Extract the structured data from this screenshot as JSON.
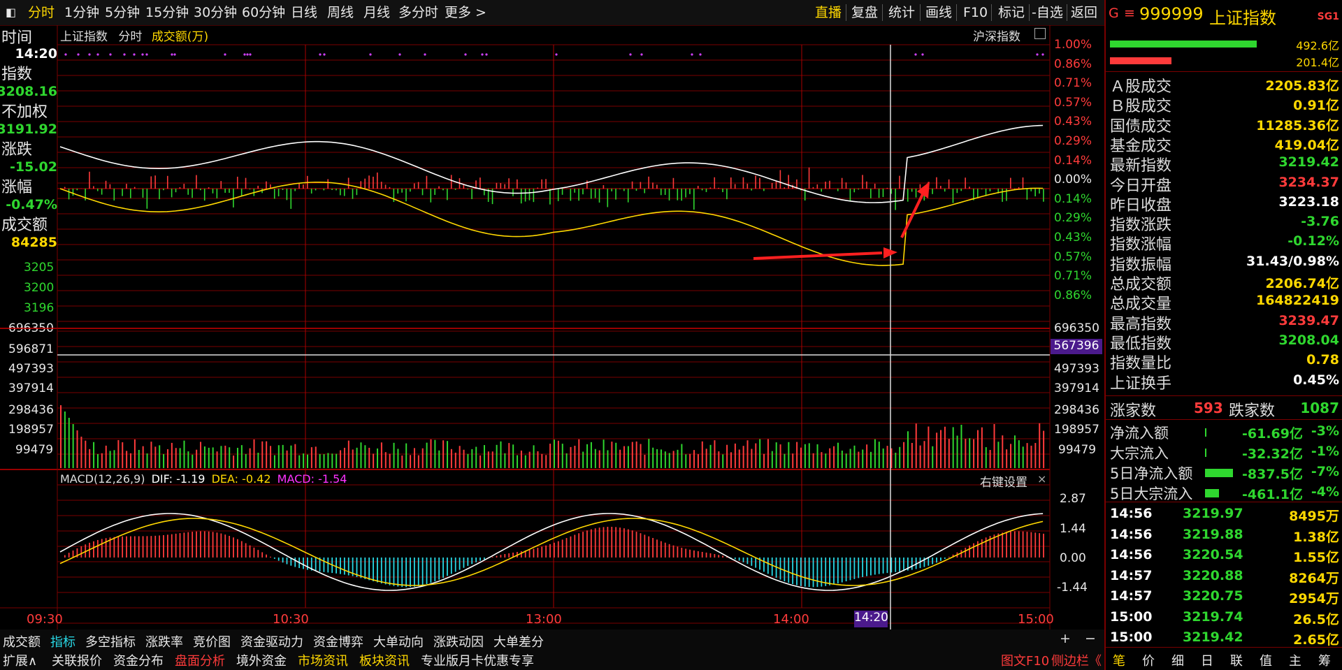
{
  "toolbar": {
    "window_icon": "window-icon",
    "periods": [
      "分时",
      "1分钟",
      "5分钟",
      "15分钟",
      "30分钟",
      "60分钟",
      "日线",
      "周线",
      "月线",
      "多分时",
      "更多 >"
    ],
    "right": [
      "直播",
      "复盘",
      "统计",
      "画线",
      "F10",
      "标记",
      "-自选",
      "返回"
    ]
  },
  "left_panel": {
    "time_label": "时间",
    "time_value": "14:20",
    "index_label": "指数",
    "index_value": "3208.16",
    "unweighted_label": "不加权",
    "unweighted_value": "3191.92",
    "change_label": "涨跌",
    "change_value": "-15.02",
    "pct_label": "涨幅",
    "pct_value": "-0.47%",
    "volume_label": "成交额",
    "volume_value": "84285"
  },
  "chart_header": {
    "name": "上证指数",
    "mode": "分时",
    "metric": "成交额(万)",
    "compare": "沪深指数"
  },
  "price_axis_left": [
    "3205",
    "3200",
    "3196"
  ],
  "pct_axis": [
    "1.00%",
    "0.86%",
    "0.71%",
    "0.57%",
    "0.43%",
    "0.29%",
    "0.14%",
    "0.00%",
    "0.14%",
    "0.29%",
    "0.43%",
    "0.57%",
    "0.71%",
    "0.86%"
  ],
  "volume_axis": [
    "696350",
    "596871",
    "497393",
    "397914",
    "298436",
    "198957",
    "99479"
  ],
  "volume_axis_right": [
    "696350",
    "497393",
    "397914",
    "298436",
    "198957",
    "99479"
  ],
  "volume_cursor": "567396",
  "macd": {
    "title": "MACD(12,26,9)",
    "dif": "DIF: -1.19",
    "dea": "DEA: -0.42",
    "macd": "MACD: -1.54",
    "settings": "右键设置",
    "axis": [
      "2.87",
      "1.44",
      "0.00",
      "-1.44"
    ]
  },
  "time_axis": [
    "09:30",
    "10:30",
    "13:00",
    "14:00",
    "15:00"
  ],
  "time_cursor": "14:20",
  "bottom_tabs_row1": [
    "成交额",
    "指标",
    "多空指标",
    "涨跌率",
    "竞价图",
    "资金驱动力",
    "资金博弈",
    "大单动向",
    "涨跌动因",
    "大单差分"
  ],
  "bottom_tabs_row2": [
    "扩展∧",
    "关联报价",
    "资金分布",
    "盘面分析",
    "境外资金",
    "市场资讯",
    "板块资讯",
    "专业版月卡优惠专享"
  ],
  "bottom_right": {
    "f10": "图文F10",
    "sidebar": "侧边栏《",
    "plus": "+",
    "minus": "−"
  },
  "right_panel": {
    "marker": "G",
    "code": "999999",
    "name": "上证指数",
    "badge": "SG1",
    "bar1": "492.6亿",
    "bar2": "201.4亿",
    "rows": [
      {
        "label": "Ａ股成交",
        "value": "2205.83亿",
        "color": "yellow"
      },
      {
        "label": "Ｂ股成交",
        "value": "0.91亿",
        "color": "yellow"
      },
      {
        "label": "国债成交",
        "value": "11285.36亿",
        "color": "yellow"
      },
      {
        "label": "基金成交",
        "value": "419.04亿",
        "color": "yellow"
      },
      {
        "label": "最新指数",
        "value": "3219.42",
        "color": "green"
      },
      {
        "label": "今日开盘",
        "value": "3234.37",
        "color": "red"
      },
      {
        "label": "昨日收盘",
        "value": "3223.18",
        "color": "white"
      },
      {
        "label": "指数涨跌",
        "value": "-3.76",
        "color": "green"
      },
      {
        "label": "指数涨幅",
        "value": "-0.12%",
        "color": "green"
      },
      {
        "label": "指数振幅",
        "value": "31.43/0.98%",
        "color": "white"
      },
      {
        "label": "总成交额",
        "value": "2206.74亿",
        "color": "yellow"
      },
      {
        "label": "总成交量",
        "value": "164822419",
        "color": "yellow"
      },
      {
        "label": "最高指数",
        "value": "3239.47",
        "color": "red"
      },
      {
        "label": "最低指数",
        "value": "3208.04",
        "color": "green"
      },
      {
        "label": "指数量比",
        "value": "0.78",
        "color": "yellow"
      },
      {
        "label": "上证换手",
        "value": "0.45%",
        "color": "white"
      }
    ],
    "up_label": "涨家数",
    "up_value": "593",
    "down_label": "跌家数",
    "down_value": "1087",
    "flows": [
      {
        "label": "净流入额",
        "value": "-61.69亿",
        "pct": "-3%"
      },
      {
        "label": "大宗流入",
        "value": "-32.32亿",
        "pct": "-1%"
      },
      {
        "label": "5日净流入额",
        "value": "-837.5亿",
        "pct": "-7%"
      },
      {
        "label": "5日大宗流入",
        "value": "-461.1亿",
        "pct": "-4%"
      }
    ],
    "trades": [
      {
        "t": "14:56",
        "p": "3219.97",
        "v": "8495万"
      },
      {
        "t": "14:56",
        "p": "3219.88",
        "v": "1.38亿"
      },
      {
        "t": "14:56",
        "p": "3220.54",
        "v": "1.55亿"
      },
      {
        "t": "14:57",
        "p": "3220.88",
        "v": "8264万"
      },
      {
        "t": "14:57",
        "p": "3220.75",
        "v": "2954万"
      },
      {
        "t": "15:00",
        "p": "3219.74",
        "v": "26.5亿"
      },
      {
        "t": "15:00",
        "p": "3219.42",
        "v": "2.65亿"
      }
    ],
    "bottom_tabs": [
      "笔",
      "价",
      "细",
      "日",
      "联",
      "值",
      "主",
      "筹"
    ]
  },
  "colors": {
    "up": "#ff3b3b",
    "down": "#2fd72f",
    "accent": "#ffd800",
    "grid": "#7a0000",
    "macd_neg": "#29d9e6"
  }
}
